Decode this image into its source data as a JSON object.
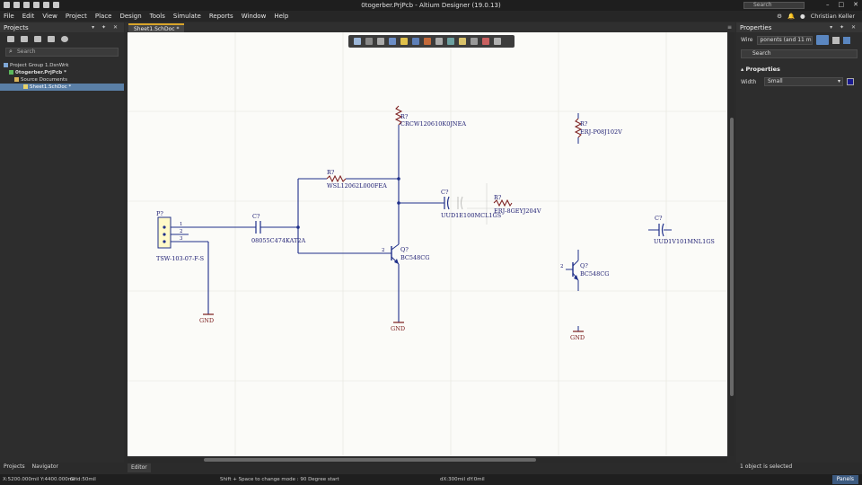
{
  "window": {
    "title": "0togerber.PrjPcb - Altium Designer (19.0.13)",
    "search_placeholder": "Search",
    "user": "Christian Keller"
  },
  "menu": [
    "File",
    "Edit",
    "View",
    "Project",
    "Place",
    "Design",
    "Tools",
    "Simulate",
    "Reports",
    "Window",
    "Help"
  ],
  "projects_panel": {
    "title": "Projects",
    "search_placeholder": "Search",
    "tree": [
      {
        "label": "Project Group 1.DsnWrk"
      },
      {
        "label": "0togerber.PrjPcb *"
      },
      {
        "label": "Source Documents"
      },
      {
        "label": "Sheet1.SchDoc *"
      }
    ]
  },
  "editor": {
    "tab": "Sheet1.SchDoc *"
  },
  "properties_panel": {
    "title": "Properties",
    "wire_label": "Wire",
    "filter_text": "ponents (and 11 more)",
    "search_placeholder": "Search",
    "section": "Properties",
    "width_label": "Width",
    "width_value": "Small",
    "selection_status": "1 object is selected"
  },
  "bottom_tabs": {
    "left": [
      "Projects",
      "Navigator"
    ],
    "editor": "Editor"
  },
  "status": {
    "coords": "X:5200.000mil Y:4400.000mil",
    "grid": "Grid:50mil",
    "hint": "Shift + Space to change mode : 90 Degree start",
    "delta": "dX:300mil dY:0mil",
    "panels": "Panels"
  },
  "schematic": {
    "components": [
      {
        "designator": "P?",
        "part": "TSW-103-07-F-S",
        "pins": [
          "1",
          "2",
          "3"
        ]
      },
      {
        "designator": "C?",
        "part": "08055C474KAT2A"
      },
      {
        "designator": "R?",
        "part": "WSL12062L000FEA"
      },
      {
        "designator": "R?",
        "part": "CRCW120610K0JNEA"
      },
      {
        "designator": "C?",
        "part": "UUD1E100MCL1GS"
      },
      {
        "designator": "R?",
        "part": "ERJ-8GEYJ204V"
      },
      {
        "designator": "Q?",
        "part": "BC548CG",
        "pin": "2"
      },
      {
        "designator": "R?",
        "part": "ERJ-P08J102V"
      },
      {
        "designator": "C?",
        "part": "UUD1V101MNL1GS"
      },
      {
        "designator": "Q?",
        "part": "BC548CG",
        "pin": "2"
      }
    ],
    "power_ports": [
      "GND",
      "GND",
      "GND"
    ]
  },
  "colors": {
    "wire": "#1f2f8a",
    "component": "#7a1a1a",
    "designator": "#1a1a70",
    "accent": "#d8a42a",
    "selection": "#5a7fa6"
  }
}
